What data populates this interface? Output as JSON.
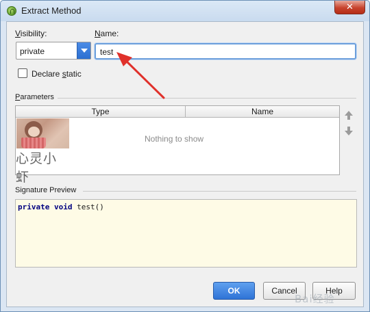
{
  "window": {
    "title": "Extract Method",
    "close_glyph": "✕"
  },
  "visibility": {
    "label_mnemonic": "V",
    "label_rest": "isibility:",
    "selected": "private"
  },
  "name": {
    "label_mnemonic": "N",
    "label_rest": "ame:",
    "value": "test"
  },
  "declare_static": {
    "label_before": "Declare ",
    "label_mnemonic": "s",
    "label_after": "tatic",
    "checked": false
  },
  "parameters": {
    "section_mnemonic": "P",
    "section_rest": "arameters",
    "columns": [
      "Type",
      "Name"
    ],
    "empty_text": "Nothing to show",
    "move_up_icon": "arrow-up-icon",
    "move_down_icon": "arrow-down-icon"
  },
  "signature_preview": {
    "section_label": "Signature Preview",
    "code_kw1": "private",
    "code_kw2": "void",
    "code_rest": "test()"
  },
  "buttons": {
    "ok": "OK",
    "cancel": "Cancel",
    "help": "Help"
  },
  "watermark": {
    "text": "心灵小虾",
    "baidu_text": "Bai经验"
  },
  "colors": {
    "accent": "#2f73d6",
    "annotation_arrow": "#e0312b",
    "preview_bg": "#fefbe6"
  }
}
